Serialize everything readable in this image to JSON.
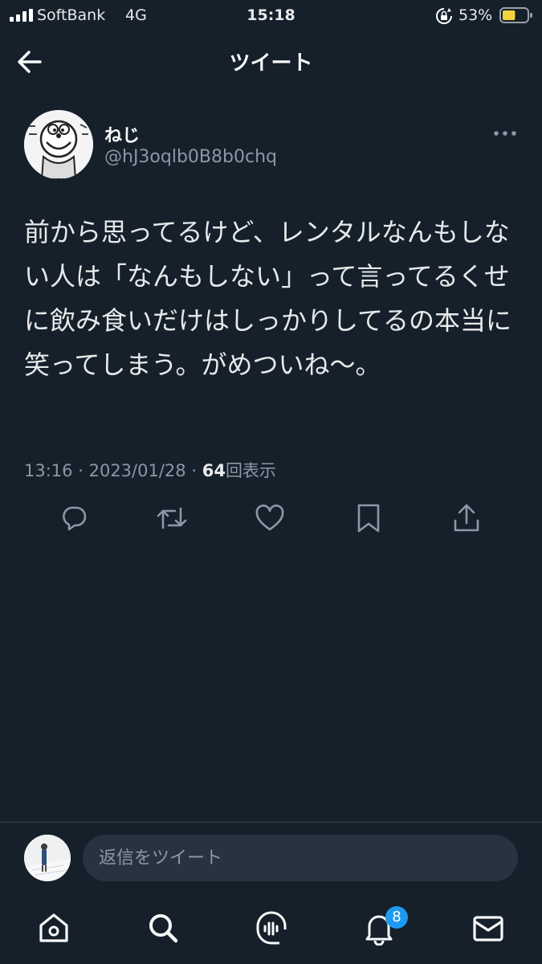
{
  "status_bar": {
    "carrier": "SoftBank",
    "network": "4G",
    "time": "15:18",
    "battery_percent": "53%",
    "battery_level": 0.53
  },
  "header": {
    "title": "ツイート",
    "back_icon": "arrow-left-icon"
  },
  "tweet": {
    "author_name": "ねじ",
    "author_handle": "@hJ3oqlb0B8b0chq",
    "text": "前から思ってるけど、レンタルなんもしない人は「なんもしない」って言ってるくせに飲み食いだけはしっかりしてるの本当に笑ってしまう。がめついね〜。",
    "time": "13:16",
    "separator": "·",
    "date": "2023/01/28",
    "views_count": "64",
    "views_label": "回表示",
    "more_icon": "more-icon",
    "actions": [
      "reply-icon",
      "retweet-icon",
      "like-icon",
      "bookmark-icon",
      "share-icon"
    ]
  },
  "reply_bar": {
    "placeholder": "返信をツイート"
  },
  "bottom_nav": {
    "items": [
      "home-icon",
      "search-icon",
      "spaces-icon",
      "notifications-icon",
      "messages-icon"
    ],
    "notifications_badge": "8"
  },
  "colors": {
    "background": "#15202b",
    "text": "#e7e9ea",
    "muted": "#8b98a5",
    "accent": "#1d9bf0",
    "battery": "#f5d33c"
  }
}
